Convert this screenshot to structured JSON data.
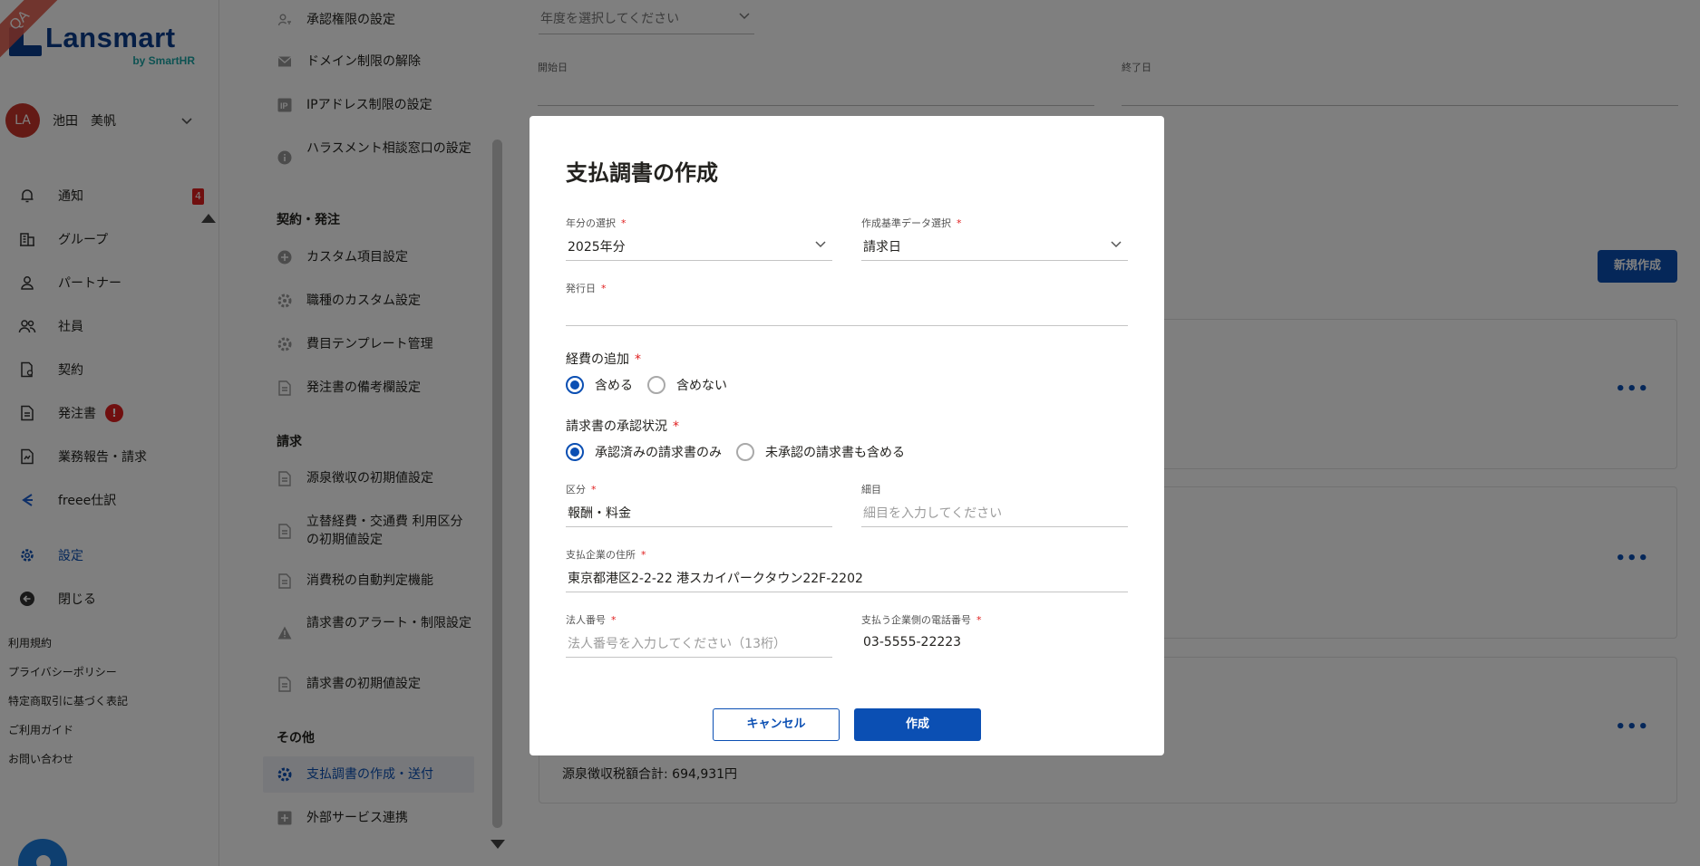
{
  "brand": {
    "name": "Lansmart",
    "sub": "by SmartHR",
    "ribbon": "QA"
  },
  "user": {
    "initials": "LA",
    "name": "池田　美帆"
  },
  "nav": {
    "items": [
      {
        "label": "通知",
        "badge": "4"
      },
      {
        "label": "グループ"
      },
      {
        "label": "パートナー"
      },
      {
        "label": "社員"
      },
      {
        "label": "契約"
      },
      {
        "label": "発注書",
        "alert": "!"
      },
      {
        "label": "業務報告・請求"
      },
      {
        "label": "freee仕訳"
      }
    ],
    "settings": "設定",
    "close": "閉じる"
  },
  "footer": [
    "利用規約",
    "プライバシーポリシー",
    "特定商取引に基づく表記",
    "ご利用ガイド",
    "お問い合わせ"
  ],
  "settings_menu": {
    "items_top": [
      {
        "label": "承認権限の設定"
      },
      {
        "label": "ドメイン制限の解除"
      },
      {
        "label": "IPアドレス制限の設定"
      },
      {
        "label": "ハラスメント相談窓口の設定"
      }
    ],
    "section_contract": "契約・発注",
    "items_contract": [
      {
        "label": "カスタム項目設定"
      },
      {
        "label": "職種のカスタム設定"
      },
      {
        "label": "費目テンプレート管理"
      },
      {
        "label": "発注書の備考欄設定"
      }
    ],
    "section_billing": "請求",
    "items_billing": [
      {
        "label": "源泉徴収の初期値設定"
      },
      {
        "label": "立替経費・交通費 利用区分の初期値設定"
      },
      {
        "label": "消費税の自動判定機能"
      },
      {
        "label": "請求書のアラート・制限設定"
      },
      {
        "label": "請求書の初期値設定"
      }
    ],
    "section_other": "その他",
    "items_other": [
      {
        "label": "支払調書の作成・送付"
      },
      {
        "label": "外部サービス連携"
      }
    ]
  },
  "main": {
    "year_placeholder": "年度を選択してください",
    "start_label": "開始日",
    "end_label": "終了日",
    "new_button": "新規作成",
    "card_bottom_text": "源泉徴収税額合計: 694,931円"
  },
  "modal": {
    "title": "支払調書の作成",
    "year_label": "年分の選択",
    "year_value": "2025年分",
    "basis_label": "作成基準データ選択",
    "basis_value": "請求日",
    "issue_label": "発行日",
    "issue_value": "",
    "expense_label": "経費の追加",
    "expense_options": [
      "含める",
      "含めない"
    ],
    "approval_label": "請求書の承認状況",
    "approval_options": [
      "承認済みの請求書のみ",
      "未承認の請求書も含める"
    ],
    "category_label": "区分",
    "category_value": "報酬・料金",
    "detail_label": "細目",
    "detail_placeholder": "細目を入力してください",
    "address_label": "支払企業の住所",
    "address_value": "東京都港区2-2-22 港スカイパークタウン22F-2202",
    "corp_label": "法人番号",
    "corp_placeholder": "法人番号を入力してください（13桁）",
    "phone_label": "支払う企業側の電話番号",
    "phone_value": "03-5555-22223",
    "cancel": "キャンセル",
    "create": "作成"
  }
}
